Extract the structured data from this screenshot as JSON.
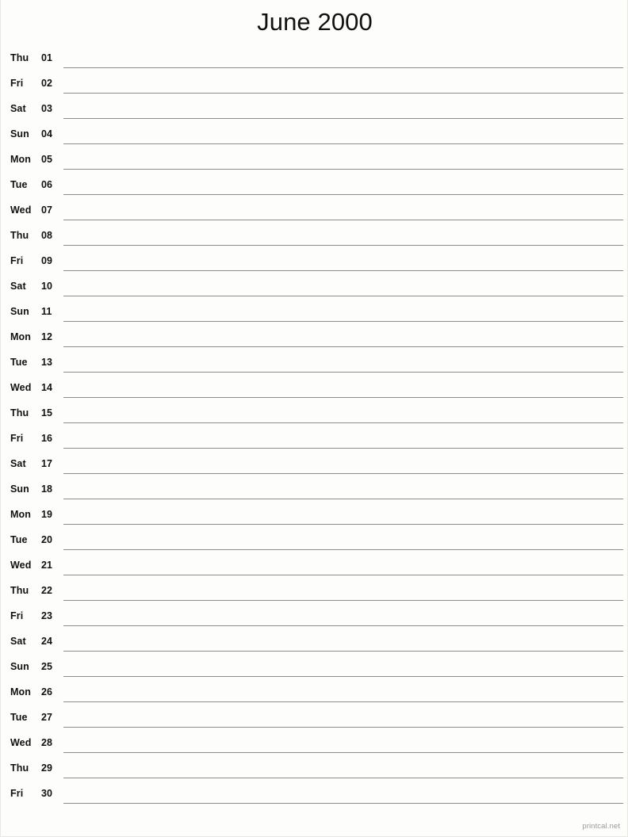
{
  "document": {
    "title": "June 2000",
    "month": "June",
    "year": "2000",
    "type": "printable-notes-calendar",
    "background_color": "#fdfdfb",
    "rule_color": "#8d8d85",
    "text_color": "#111111",
    "footer_color": "#9a9a9a"
  },
  "footer": {
    "branding": "printcal.net"
  },
  "days": [
    {
      "dow": "Thu",
      "num": "01"
    },
    {
      "dow": "Fri",
      "num": "02"
    },
    {
      "dow": "Sat",
      "num": "03"
    },
    {
      "dow": "Sun",
      "num": "04"
    },
    {
      "dow": "Mon",
      "num": "05"
    },
    {
      "dow": "Tue",
      "num": "06"
    },
    {
      "dow": "Wed",
      "num": "07"
    },
    {
      "dow": "Thu",
      "num": "08"
    },
    {
      "dow": "Fri",
      "num": "09"
    },
    {
      "dow": "Sat",
      "num": "10"
    },
    {
      "dow": "Sun",
      "num": "11"
    },
    {
      "dow": "Mon",
      "num": "12"
    },
    {
      "dow": "Tue",
      "num": "13"
    },
    {
      "dow": "Wed",
      "num": "14"
    },
    {
      "dow": "Thu",
      "num": "15"
    },
    {
      "dow": "Fri",
      "num": "16"
    },
    {
      "dow": "Sat",
      "num": "17"
    },
    {
      "dow": "Sun",
      "num": "18"
    },
    {
      "dow": "Mon",
      "num": "19"
    },
    {
      "dow": "Tue",
      "num": "20"
    },
    {
      "dow": "Wed",
      "num": "21"
    },
    {
      "dow": "Thu",
      "num": "22"
    },
    {
      "dow": "Fri",
      "num": "23"
    },
    {
      "dow": "Sat",
      "num": "24"
    },
    {
      "dow": "Sun",
      "num": "25"
    },
    {
      "dow": "Mon",
      "num": "26"
    },
    {
      "dow": "Tue",
      "num": "27"
    },
    {
      "dow": "Wed",
      "num": "28"
    },
    {
      "dow": "Thu",
      "num": "29"
    },
    {
      "dow": "Fri",
      "num": "30"
    }
  ]
}
